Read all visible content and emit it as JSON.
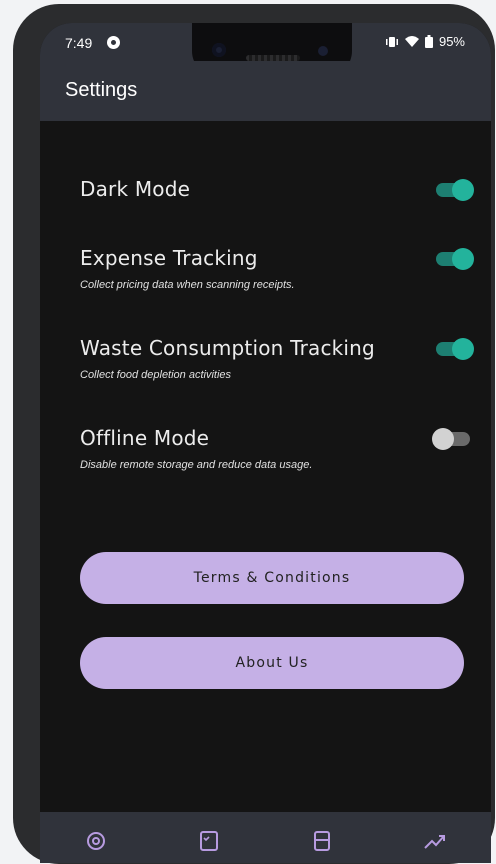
{
  "status": {
    "time": "7:49",
    "battery": "95%"
  },
  "appbar": {
    "title": "Settings"
  },
  "settings": [
    {
      "label": "Dark Mode",
      "description": "",
      "on": true
    },
    {
      "label": "Expense Tracking",
      "description": "Collect pricing data when scanning receipts.",
      "on": true
    },
    {
      "label": "Waste Consumption Tracking",
      "description": "Collect food depletion activities",
      "on": true
    },
    {
      "label": "Offline Mode",
      "description": "Disable remote storage and reduce data usage.",
      "on": false
    }
  ],
  "buttons": {
    "terms": "Terms & Conditions",
    "about": "About Us"
  },
  "nav": [
    "settings-icon",
    "checklist-icon",
    "receipt-icon",
    "trend-icon"
  ],
  "colors": {
    "accent": "#23b39c",
    "button": "#c5b0e6",
    "bar": "#30333b",
    "background": "#141414"
  }
}
